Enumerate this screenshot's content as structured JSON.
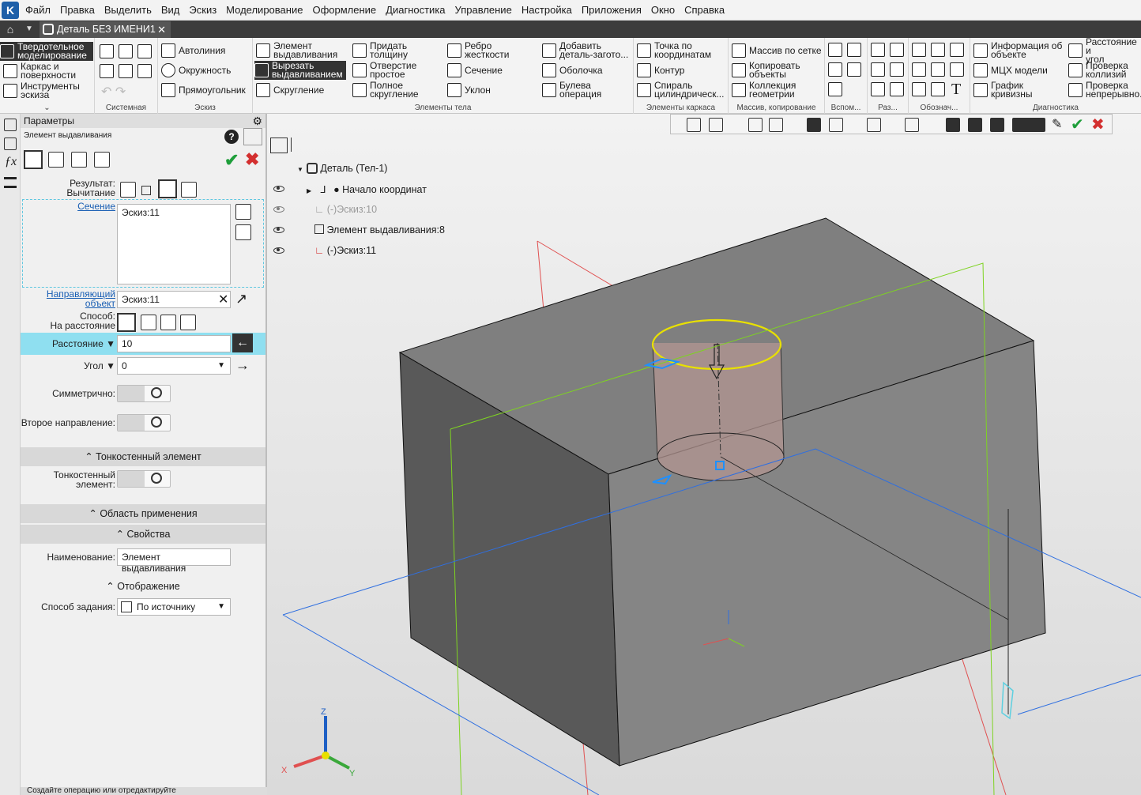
{
  "menu": [
    "Файл",
    "Правка",
    "Выделить",
    "Вид",
    "Эскиз",
    "Моделирование",
    "Оформление",
    "Диагностика",
    "Управление",
    "Настройка",
    "Приложения",
    "Окно",
    "Справка"
  ],
  "tab": {
    "title": "Деталь БЕЗ ИМЕНИ1",
    "close": "✕"
  },
  "ribbon": {
    "modes": [
      "Твердотельное\nмоделирование",
      "Каркас и\nповерхности",
      "Инструменты\nэскиза"
    ],
    "groups": {
      "system": "Системная",
      "sketch": "Эскиз",
      "body": "Элементы тела",
      "frame": "Элементы каркаса",
      "array": "Массив, копирование",
      "aux": "Вспом...",
      "razr": "Раз...",
      "notation": "Обознач...",
      "diag": "Диагностика"
    },
    "sketch_items": [
      "Автолиния",
      "Окружность",
      "Прямоугольник"
    ],
    "body_items": [
      "Элемент\nвыдавливания",
      "Вырезать\nвыдавливанием",
      "Скругление",
      "Придать\nтолщину",
      "Отверстие\nпростое",
      "Полное\nскругление",
      "Ребро\nжесткости",
      "Сечение",
      "Уклон",
      "Добавить\nдеталь-загото...",
      "Оболочка",
      "Булева\nоперация"
    ],
    "frame_items": [
      "Точка по\nкоординатам",
      "Контур",
      "Спираль\nцилиндрическ..."
    ],
    "array_items": [
      "Массив по сетке",
      "Копировать\nобъекты",
      "Коллекция\nгеометрии"
    ],
    "diag_items": [
      "Информация об\nобъекте",
      "МЦХ модели",
      "График\nкривизны",
      "Расстояние и\nугол",
      "Проверка\nколлизий",
      "Проверка\nнепрерывно..."
    ]
  },
  "params": {
    "header": "Параметры",
    "element_title": "Элемент выдавливания",
    "result_label": "Результат:\nВычитание",
    "section_link": "Сечение",
    "section_value": "Эскиз:11",
    "guide_link": "Направляющий\nобъект",
    "guide_value": "Эскиз:11",
    "method_label": "Способ:\nНа расстояние",
    "distance_label": "Расстояние",
    "distance_value": "10",
    "angle_label": "Угол",
    "angle_value": "0",
    "symmetric_label": "Симметрично:",
    "second_dir_label": "Второе направление:",
    "thin_section": "Тонкостенный элемент",
    "thin_label": "Тонкостенный\nэлемент:",
    "scope_section": "Область применения",
    "props_section": "Свойства",
    "name_label": "Наименование:",
    "name_value": "Элемент выдавливания",
    "display_section": "Отображение",
    "method2_label": "Способ задания:",
    "method2_value": "По источнику",
    "status_text": "Создайте операцию или отредактируйте"
  },
  "tree": {
    "root": "Деталь (Тел-1)",
    "origin": "Начало координат",
    "sketch10": "(-)Эскиз:10",
    "extrude8": "Элемент выдавливания:8",
    "sketch11": "(-)Эскиз:11"
  },
  "axes": {
    "z": "Z",
    "x": "X",
    "y": "Y"
  },
  "colors": {
    "accent": "#8fdff0",
    "sketch_selected": "#e8e000",
    "plane_green": "#7ed321",
    "plane_blue": "#2f6fe0",
    "plane_red": "#e05050",
    "ok": "#1e9e3a",
    "cancel": "#d32f2f"
  }
}
